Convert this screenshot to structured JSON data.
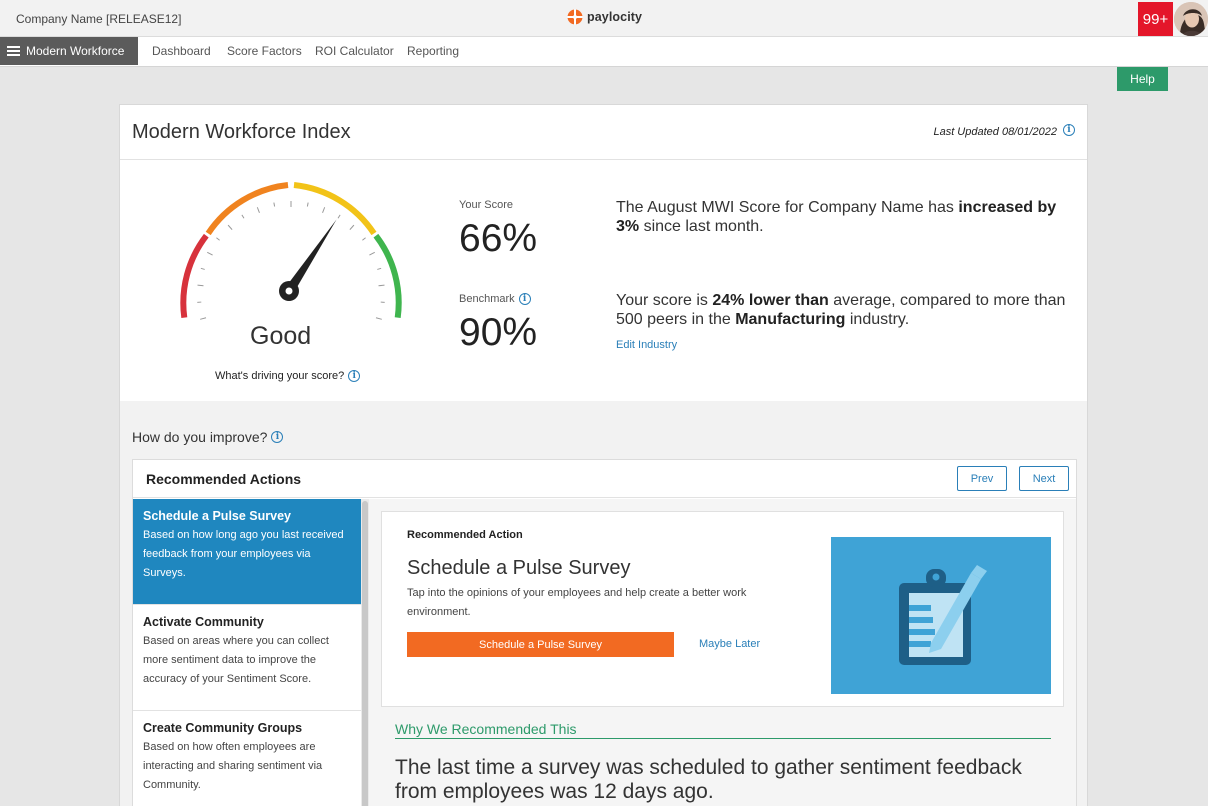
{
  "topbar": {
    "company": "Company Name [RELEASE12]",
    "brand": "paylocity",
    "notifications": "99+"
  },
  "nav": {
    "menu_label": "Modern Workforce",
    "links": [
      "Dashboard",
      "Score Factors",
      "ROI Calculator",
      "Reporting"
    ]
  },
  "help_label": "Help",
  "card": {
    "title": "Modern Workforce Index",
    "last_updated": "Last Updated 08/01/2022"
  },
  "gauge": {
    "label": "Good",
    "level_percent": 66,
    "driving_text": "What's driving your score?"
  },
  "score": {
    "your_score_label": "Your Score",
    "your_score": "66%",
    "benchmark_label": "Benchmark",
    "benchmark": "90%"
  },
  "summary": {
    "s1_a": "The August MWI Score for Company Name has ",
    "s1_b": "increased by 3%",
    "s1_c": " since last month.",
    "s2_a": "Your score is ",
    "s2_b": "24% lower than",
    "s2_c": " average, compared to more than 500 peers in the ",
    "s2_d": "Manufacturing",
    "s2_e": " industry.",
    "edit_industry": "Edit Industry"
  },
  "improve": {
    "heading": "How do you improve?",
    "actions_title": "Recommended Actions",
    "prev": "Prev",
    "next": "Next",
    "items": [
      {
        "title": "Schedule a Pulse Survey",
        "desc": "Based on how long ago you last received feedback from your employees via Surveys."
      },
      {
        "title": "Activate Community",
        "desc": "Based on areas where you can collect more sentiment data to improve the accuracy of your Sentiment Score."
      },
      {
        "title": "Create Community Groups",
        "desc": "Based on how often employees are interacting and sharing sentiment via Community."
      }
    ],
    "detail": {
      "label": "Recommended Action",
      "title": "Schedule a Pulse Survey",
      "desc": "Tap into the opinions of your employees and help create a better work environment.",
      "cta": "Schedule a Pulse Survey",
      "maybe": "Maybe Later",
      "why_heading": "Why We Recommended This",
      "why_text": "The last time a survey was scheduled to gather sentiment feedback from employees was 12 days ago."
    }
  },
  "colors": {
    "accent_blue": "#1f87bf",
    "green": "#2d9a6a",
    "orange": "#f26a22",
    "badge_red": "#e4162a"
  }
}
